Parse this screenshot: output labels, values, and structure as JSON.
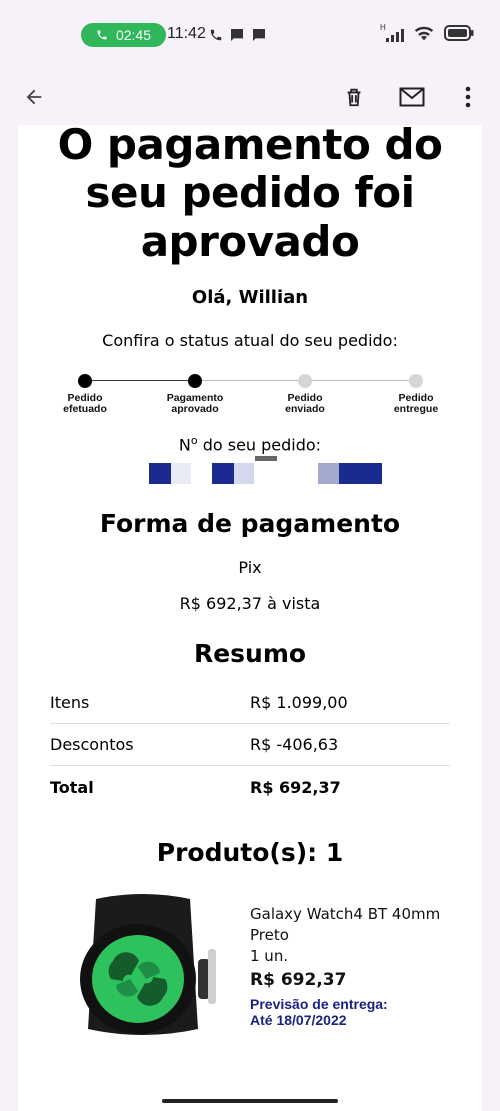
{
  "status_bar": {
    "call_timer": "02:45",
    "clock": "11:42",
    "network_label": "H"
  },
  "toolbar": {
    "back": "arrow-left-icon",
    "delete": "trash-icon",
    "mail": "envelope-icon",
    "more": "more-vertical-icon"
  },
  "email": {
    "headline": "O pagamento do seu pedido foi aprovado",
    "greeting": "Olá, Willian",
    "status_intro": "Confira o status atual do seu pedido:",
    "steps": [
      {
        "label_line1": "Pedido",
        "label_line2": "efetuado",
        "done": true
      },
      {
        "label_line1": "Pagamento",
        "label_line2": "aprovado",
        "done": true
      },
      {
        "label_line1": "Pedido",
        "label_line2": "enviado",
        "done": false
      },
      {
        "label_line1": "Pedido",
        "label_line2": "entregue",
        "done": false
      }
    ],
    "order_number_label_prefix": "N",
    "order_number_label_sup": "o",
    "order_number_label_suffix": " do seu pedido:",
    "payment": {
      "title": "Forma de pagamento",
      "method": "Pix",
      "amount": "R$ 692,37 à vista"
    },
    "summary": {
      "title": "Resumo",
      "rows": [
        {
          "label": "Itens",
          "value": "R$ 1.099,00"
        },
        {
          "label": "Descontos",
          "value": "R$ -406,63"
        },
        {
          "label": "Total",
          "value": "R$ 692,37"
        }
      ]
    },
    "products": {
      "title": "Produto(s): 1",
      "item": {
        "name": "Galaxy Watch4 BT 40mm Preto",
        "qty": "1 un.",
        "price": "R$ 692,37",
        "delivery_label": "Previsão de entrega:",
        "delivery_date": "Até 18/07/2022"
      }
    }
  },
  "colors": {
    "chrome_bg": "#f7f2fa",
    "call_pill": "#2fb75a",
    "delivery_text": "#1a237e",
    "censor_blue": "#1b2a8f"
  }
}
